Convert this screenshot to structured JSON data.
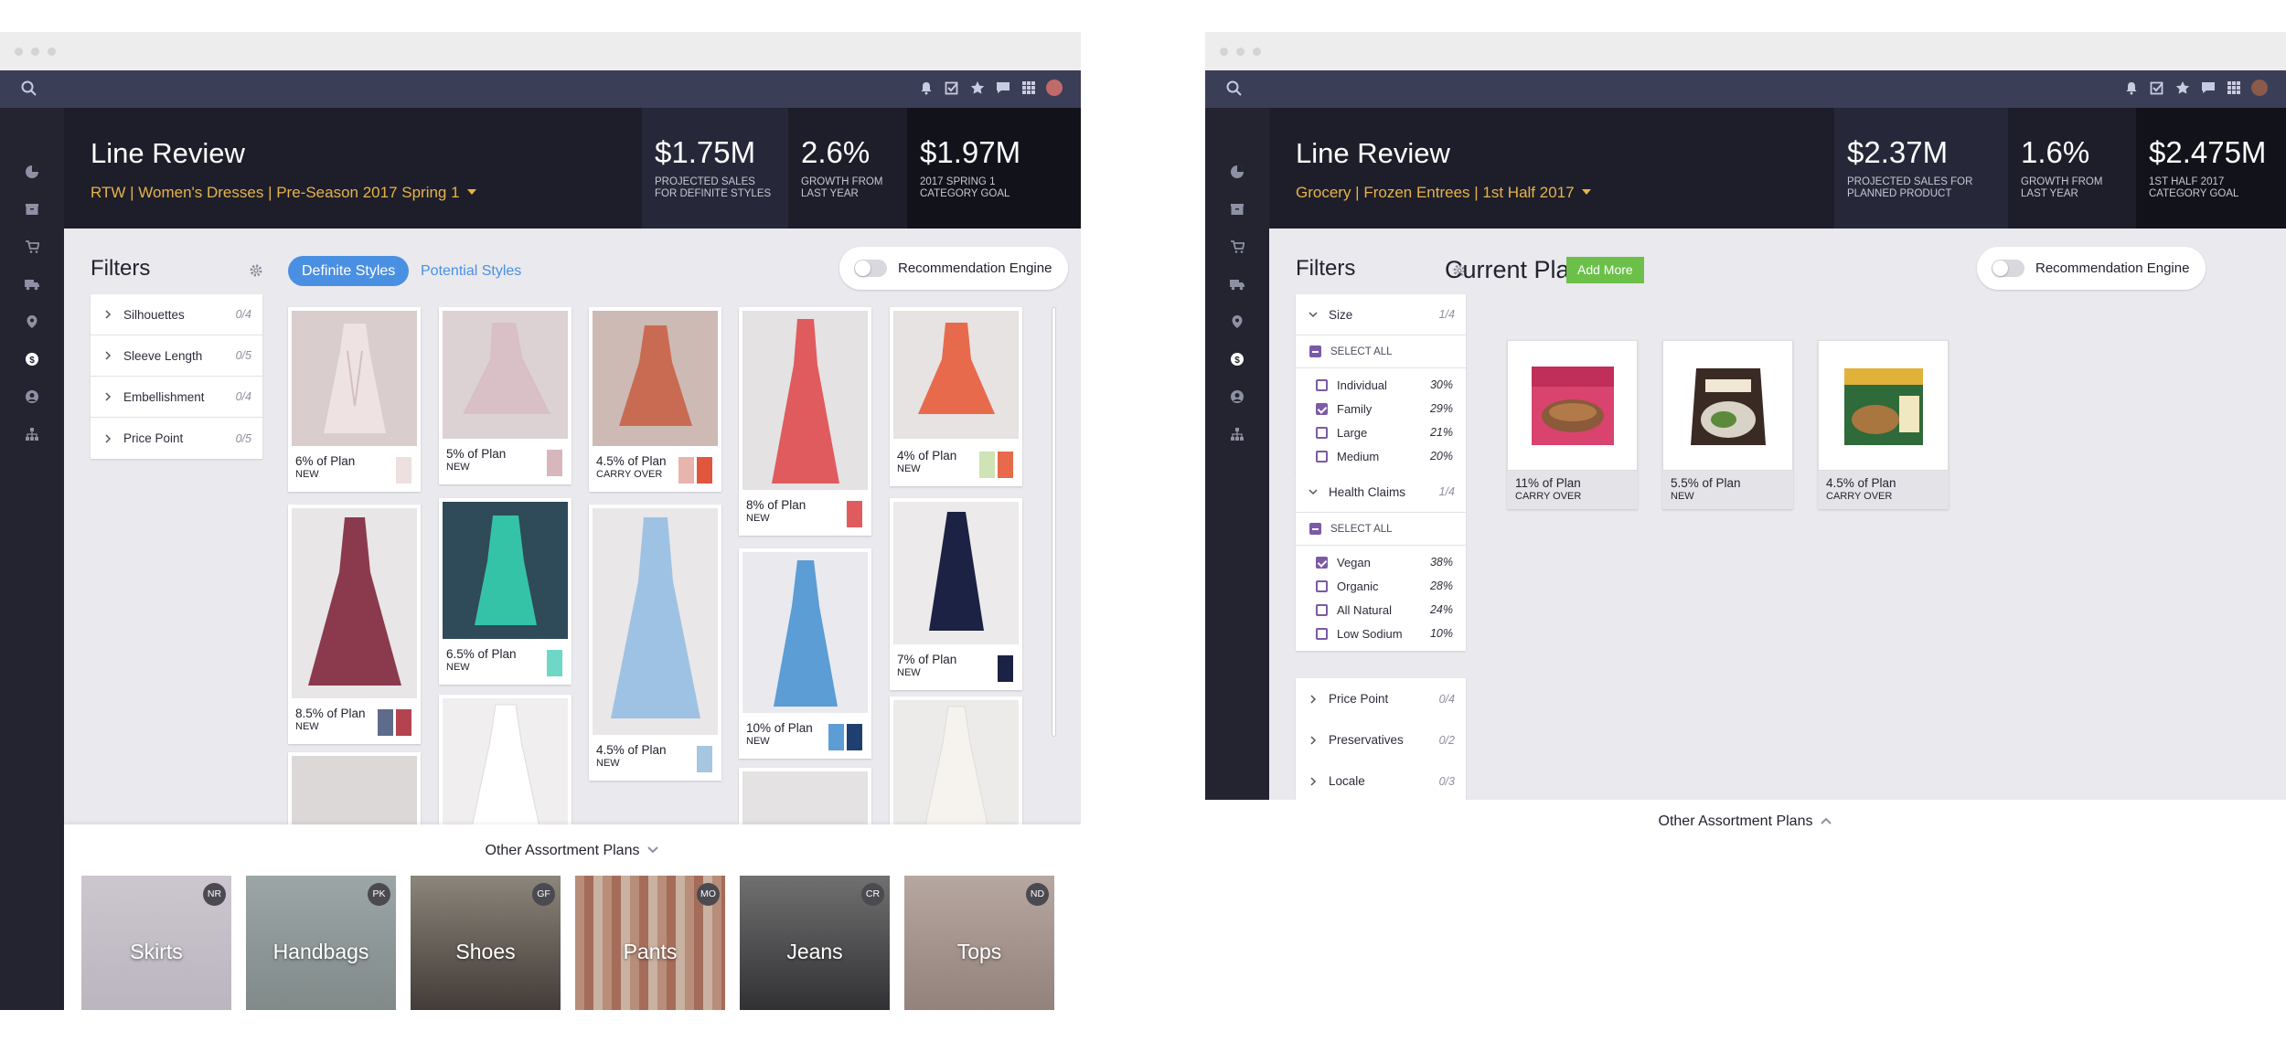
{
  "window_left": {
    "header": {
      "title": "Line Review",
      "breadcrumb": "RTW | Women's Dresses | Pre-Season 2017 Spring 1",
      "kpis": [
        {
          "value": "$1.75M",
          "label1": "PROJECTED SALES",
          "label2": "FOR DEFINITE STYLES"
        },
        {
          "value": "2.6%",
          "label1": "GROWTH FROM",
          "label2": "LAST YEAR"
        },
        {
          "value": "$1.97M",
          "label1": "2017 SPRING 1",
          "label2": "CATEGORY GOAL"
        }
      ]
    },
    "filters": {
      "title": "Filters",
      "items": [
        {
          "label": "Silhouettes",
          "count": "0/4"
        },
        {
          "label": "Sleeve Length",
          "count": "0/5"
        },
        {
          "label": "Embellishment",
          "count": "0/4"
        },
        {
          "label": "Price Point",
          "count": "0/5"
        }
      ]
    },
    "tabs": {
      "active": "Definite Styles",
      "inactive": "Potential Styles"
    },
    "recommendation": "Recommendation Engine",
    "products": [
      {
        "pct": "6% of Plan",
        "tag": "NEW",
        "colors": [
          "#eee0e0"
        ]
      },
      {
        "pct": "5% of Plan",
        "tag": "NEW",
        "colors": [
          "#d7b6bc"
        ]
      },
      {
        "pct": "4.5% of Plan",
        "tag": "CARRY OVER",
        "colors": [
          "#e7b4ae",
          "#e0563e"
        ]
      },
      {
        "pct": "8% of Plan",
        "tag": "NEW",
        "colors": [
          "#e05b5e"
        ]
      },
      {
        "pct": "4% of Plan",
        "tag": "NEW",
        "colors": [
          "#cfe3b6",
          "#e86a4c"
        ]
      },
      {
        "pct": "8.5% of Plan",
        "tag": "NEW",
        "colors": [
          "#5e6b8a",
          "#b3434f"
        ]
      },
      {
        "pct": "6.5% of Plan",
        "tag": "NEW",
        "colors": [
          "#6ed7c6"
        ]
      },
      {
        "pct": "4.5% of Plan",
        "tag": "NEW",
        "colors": [
          "#a7c6e0"
        ]
      },
      {
        "pct": "10% of Plan",
        "tag": "NEW",
        "colors": [
          "#5b9dd4",
          "#1f3f70"
        ]
      },
      {
        "pct": "7% of Plan",
        "tag": "NEW",
        "colors": [
          "#1c2244"
        ]
      }
    ],
    "other_plans": {
      "title": "Other Assortment Plans",
      "categories": [
        {
          "label": "Skirts",
          "badge": "NR"
        },
        {
          "label": "Handbags",
          "badge": "PK"
        },
        {
          "label": "Shoes",
          "badge": "GF"
        },
        {
          "label": "Pants",
          "badge": "MO"
        },
        {
          "label": "Jeans",
          "badge": "CR"
        },
        {
          "label": "Tops",
          "badge": "ND"
        }
      ]
    }
  },
  "window_right": {
    "header": {
      "title": "Line Review",
      "breadcrumb": "Grocery | Frozen Entrees | 1st Half 2017",
      "kpis": [
        {
          "value": "$2.37M",
          "label1": "PROJECTED SALES FOR",
          "label2": "PLANNED PRODUCT"
        },
        {
          "value": "1.6%",
          "label1": "GROWTH FROM",
          "label2": "LAST YEAR"
        },
        {
          "value": "$2.475M",
          "label1": "1ST HALF 2017",
          "label2": "CATEGORY GOAL"
        }
      ]
    },
    "filters": {
      "title": "Filters",
      "size": {
        "label": "Size",
        "count": "1/4",
        "select_all": "SELECT ALL",
        "options": [
          {
            "label": "Individual",
            "pct": "30%",
            "checked": false
          },
          {
            "label": "Family",
            "pct": "29%",
            "checked": true
          },
          {
            "label": "Large",
            "pct": "21%",
            "checked": false
          },
          {
            "label": "Medium",
            "pct": "20%",
            "checked": false
          }
        ]
      },
      "health": {
        "label": "Health Claims",
        "count": "1/4",
        "select_all": "SELECT ALL",
        "options": [
          {
            "label": "Vegan",
            "pct": "38%",
            "checked": true
          },
          {
            "label": "Organic",
            "pct": "28%",
            "checked": false
          },
          {
            "label": "All Natural",
            "pct": "24%",
            "checked": false
          },
          {
            "label": "Low Sodium",
            "pct": "10%",
            "checked": false
          }
        ]
      },
      "collapsed": [
        {
          "label": "Price Point",
          "count": "0/4"
        },
        {
          "label": "Preservatives",
          "count": "0/2"
        },
        {
          "label": "Locale",
          "count": "0/3"
        }
      ]
    },
    "plan": {
      "title": "Current Plan",
      "add_more": "Add More",
      "items": [
        {
          "pct": "11% of Plan",
          "tag": "CARRY OVER"
        },
        {
          "pct": "5.5% of Plan",
          "tag": "NEW"
        },
        {
          "pct": "4.5% of Plan",
          "tag": "CARRY OVER"
        }
      ]
    },
    "recommendation": "Recommendation Engine",
    "other_plans": {
      "title": "Other Assortment Plans"
    }
  }
}
